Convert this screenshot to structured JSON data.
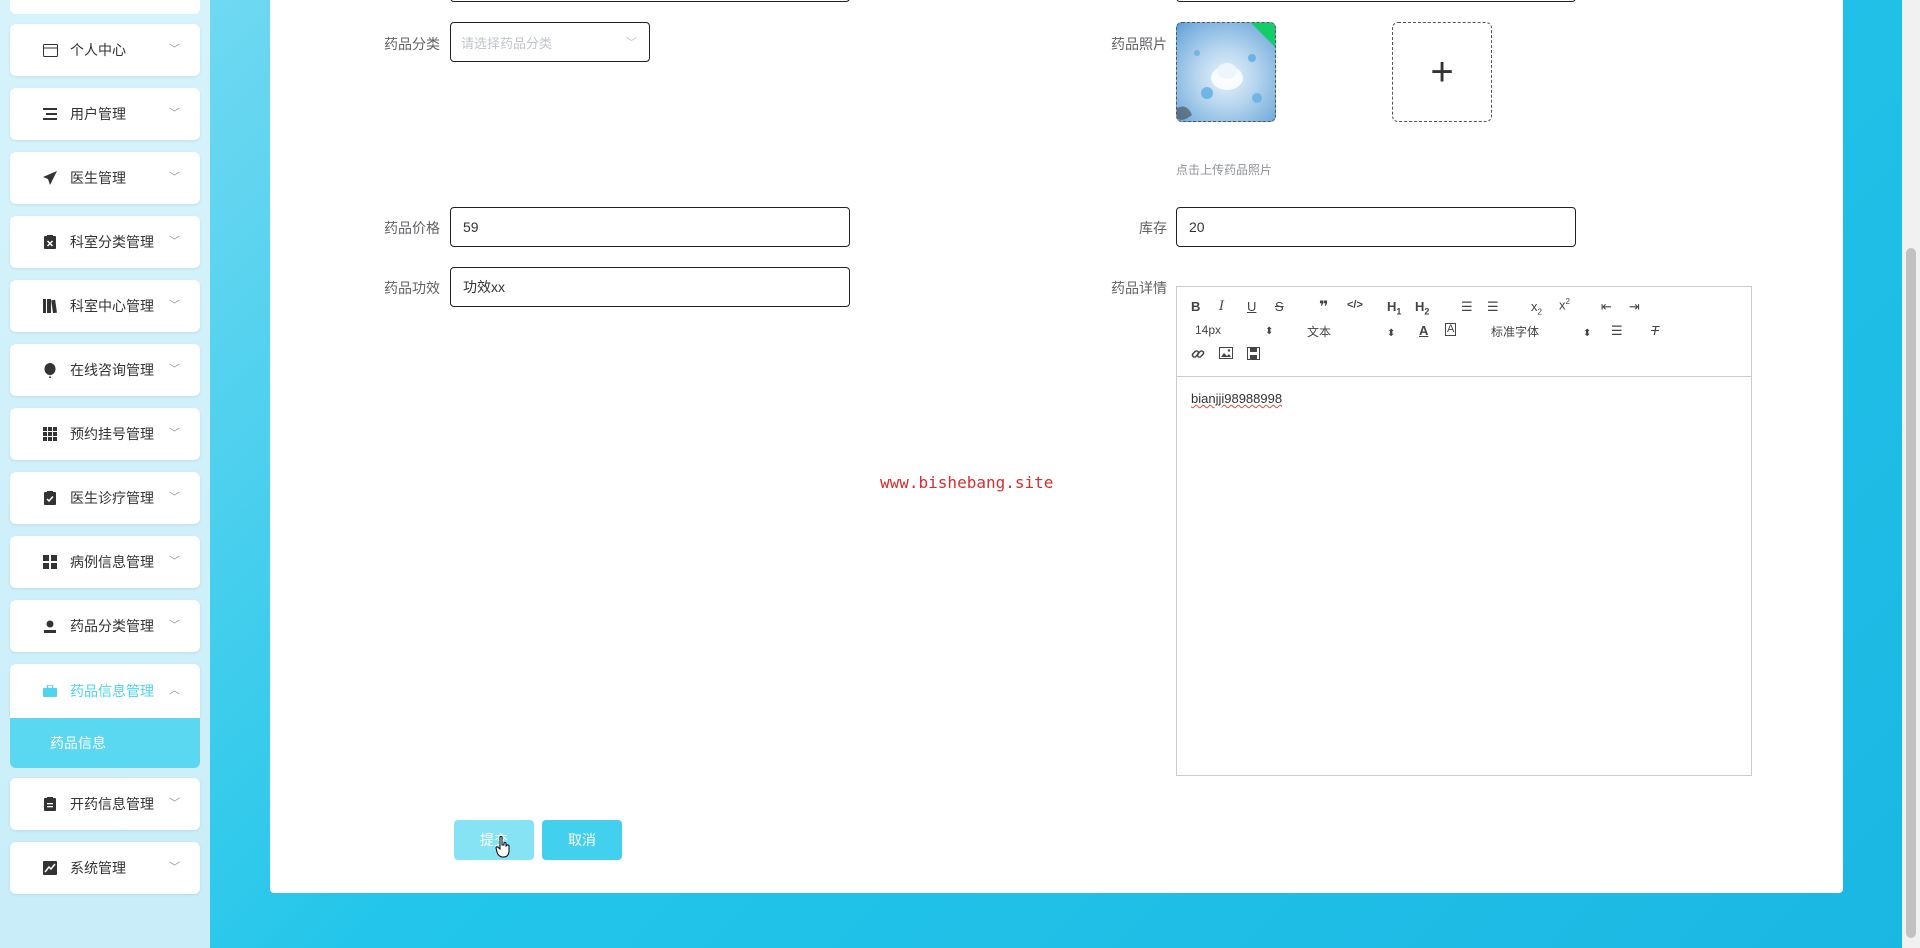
{
  "sidebar": {
    "items": [
      {
        "label": "个人中心",
        "icon": "card-icon"
      },
      {
        "label": "用户管理",
        "icon": "list-icon"
      },
      {
        "label": "医生管理",
        "icon": "send-icon"
      },
      {
        "label": "科室分类管理",
        "icon": "clipboard-x-icon"
      },
      {
        "label": "科室中心管理",
        "icon": "book-icon"
      },
      {
        "label": "在线咨询管理",
        "icon": "balloon-icon"
      },
      {
        "label": "预约挂号管理",
        "icon": "grid-icon"
      },
      {
        "label": "医生诊疗管理",
        "icon": "clipboard-check-icon"
      },
      {
        "label": "病例信息管理",
        "icon": "apps-icon"
      },
      {
        "label": "药品分类管理",
        "icon": "user-icon"
      },
      {
        "label": "药品信息管理",
        "icon": "briefcase-icon",
        "active": true
      },
      {
        "label": "开药信息管理",
        "icon": "clipboard-icon"
      },
      {
        "label": "系统管理",
        "icon": "chart-icon"
      }
    ],
    "submenu": {
      "label": "药品信息"
    }
  },
  "form": {
    "category_label": "药品分类",
    "category_placeholder": "请选择药品分类",
    "photo_label": "药品照片",
    "photo_tip": "点击上传药品照片",
    "price_label": "药品价格",
    "price_value": "59",
    "stock_label": "库存",
    "stock_value": "20",
    "effect_label": "药品功效",
    "effect_value": "功效xx",
    "detail_label": "药品详情",
    "editor": {
      "font_size": "14px",
      "text_style": "文本",
      "font_family": "标准字体",
      "content": "bianjji98988998"
    },
    "submit_label": "提交",
    "cancel_label": "取消"
  },
  "watermark": "www.bishebang.site",
  "colors": {
    "accent": "#4fd3ee",
    "submit": "#86e3f3",
    "cancel": "#42d0ef"
  }
}
